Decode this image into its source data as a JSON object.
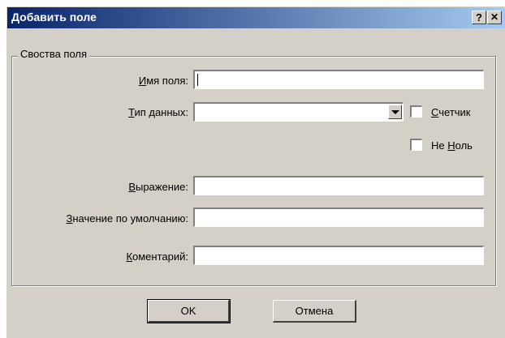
{
  "window": {
    "title": "Добавить поле",
    "help_button": "?",
    "close_button": "✕"
  },
  "group": {
    "title": "Своства поля"
  },
  "fields": {
    "name": {
      "label_access": "И",
      "label_rest": "мя поля:",
      "value": ""
    },
    "datatype": {
      "label_access": "Т",
      "label_rest": "ип данных:",
      "value": ""
    },
    "expression": {
      "label_pre": "",
      "label_access": "В",
      "label_rest": "ыражение:",
      "value": ""
    },
    "default_value": {
      "label_access": "З",
      "label_rest": "начение по умолчанию:",
      "value": ""
    },
    "comment": {
      "label_access": "К",
      "label_rest": "оментарий:",
      "value": ""
    }
  },
  "checkboxes": {
    "counter": {
      "label_access": "С",
      "label_rest": "четчик",
      "checked": false
    },
    "not_null": {
      "label_pre": "Не ",
      "label_access": "Н",
      "label_rest": "оль",
      "checked": false
    }
  },
  "buttons": {
    "ok": "OK",
    "cancel": "Отмена"
  }
}
